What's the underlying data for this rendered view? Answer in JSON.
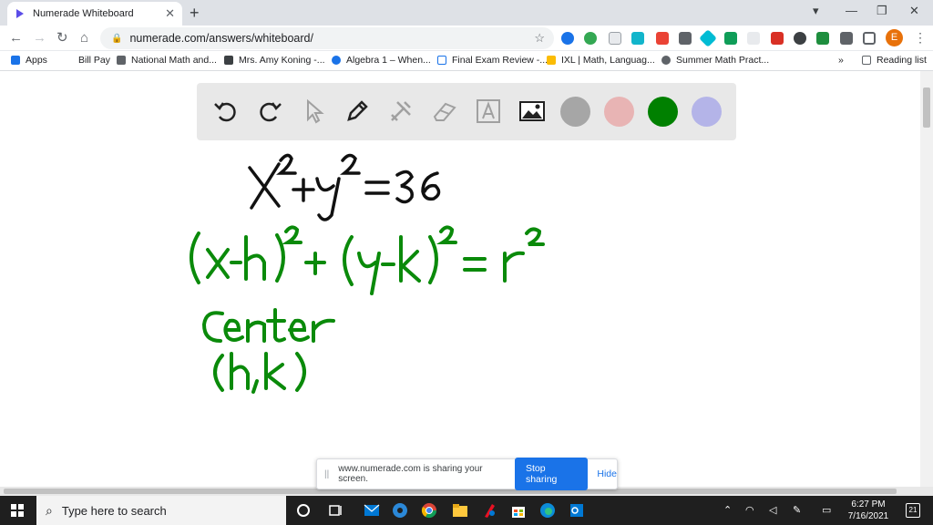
{
  "tab": {
    "title": "Numerade Whiteboard",
    "close": "✕"
  },
  "new_tab": "+",
  "window_controls": {
    "chevron": "▾",
    "minimize": "—",
    "restore": "❐",
    "close": "✕"
  },
  "nav": {
    "back": "←",
    "forward": "→",
    "reload": "↻",
    "home": "⌂"
  },
  "address": {
    "url": "numerade.com/answers/whiteboard/",
    "lock": "🔒",
    "star": "☆"
  },
  "profile_initial": "E",
  "menu": "⋮",
  "bookmarks": {
    "items": [
      {
        "label": "Apps",
        "color": "#1a73e8"
      },
      {
        "label": "Bill Pay",
        "color": "#ffffff"
      },
      {
        "label": "National Math and...",
        "color": "#5f6368"
      },
      {
        "label": "Mrs. Amy Koning -...",
        "color": "#3c4043"
      },
      {
        "label": "Algebra 1 – When...",
        "color": "#1a73e8"
      },
      {
        "label": "Final Exam Review -...",
        "color": "#1a73e8"
      },
      {
        "label": "IXL | Math, Languag...",
        "color": "#fbbc04"
      },
      {
        "label": "Summer Math Pract...",
        "color": "#a142f4"
      }
    ],
    "overflow": "»",
    "reading_list": "Reading list"
  },
  "whiteboard": {
    "colors": [
      "#a6a6a6",
      "#e8b4b4",
      "#008000",
      "#b4b4e8"
    ],
    "equation_line1": "X²+y² = 36",
    "equation_line2": "(x-h)² + (y-k)² = r²",
    "note_line1": "Center",
    "note_line2": "(h,k)"
  },
  "sharebar": {
    "grip": "||",
    "message": "www.numerade.com is sharing your screen.",
    "stop": "Stop sharing",
    "hide": "Hide"
  },
  "taskbar": {
    "search_placeholder": "Type here to search",
    "search_icon": "⌕",
    "time": "6:27 PM",
    "date": "7/16/2021",
    "notifications": "21"
  }
}
